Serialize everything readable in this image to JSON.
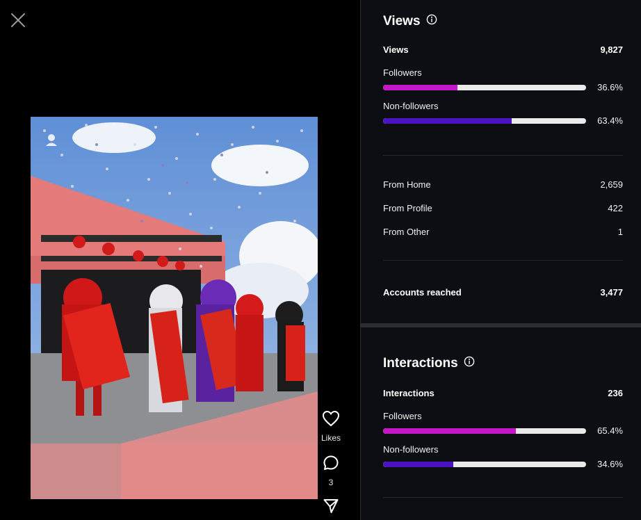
{
  "colors": {
    "followers_bar": "#c317c8",
    "nonfollowers_bar": "#4a12c0",
    "track": "#eaeaea",
    "panel_bg": "#0c0e13"
  },
  "left": {
    "close_icon": "close-icon",
    "actions": {
      "likes_label": "Likes",
      "comments_count": "3"
    }
  },
  "views": {
    "title": "Views",
    "total_label": "Views",
    "total_value": "9,827",
    "followers": {
      "label": "Followers",
      "pct_text": "36.6%",
      "pct": 36.6
    },
    "nonfollowers": {
      "label": "Non-followers",
      "pct_text": "63.4%",
      "pct": 63.4
    },
    "sources": [
      {
        "label": "From Home",
        "value": "2,659"
      },
      {
        "label": "From Profile",
        "value": "422"
      },
      {
        "label": "From Other",
        "value": "1"
      }
    ],
    "reached_label": "Accounts reached",
    "reached_value": "3,477"
  },
  "interactions": {
    "title": "Interactions",
    "total_label": "Interactions",
    "total_value": "236",
    "followers": {
      "label": "Followers",
      "pct_text": "65.4%",
      "pct": 65.4
    },
    "nonfollowers": {
      "label": "Non-followers",
      "pct_text": "34.6%",
      "pct": 34.6
    }
  }
}
